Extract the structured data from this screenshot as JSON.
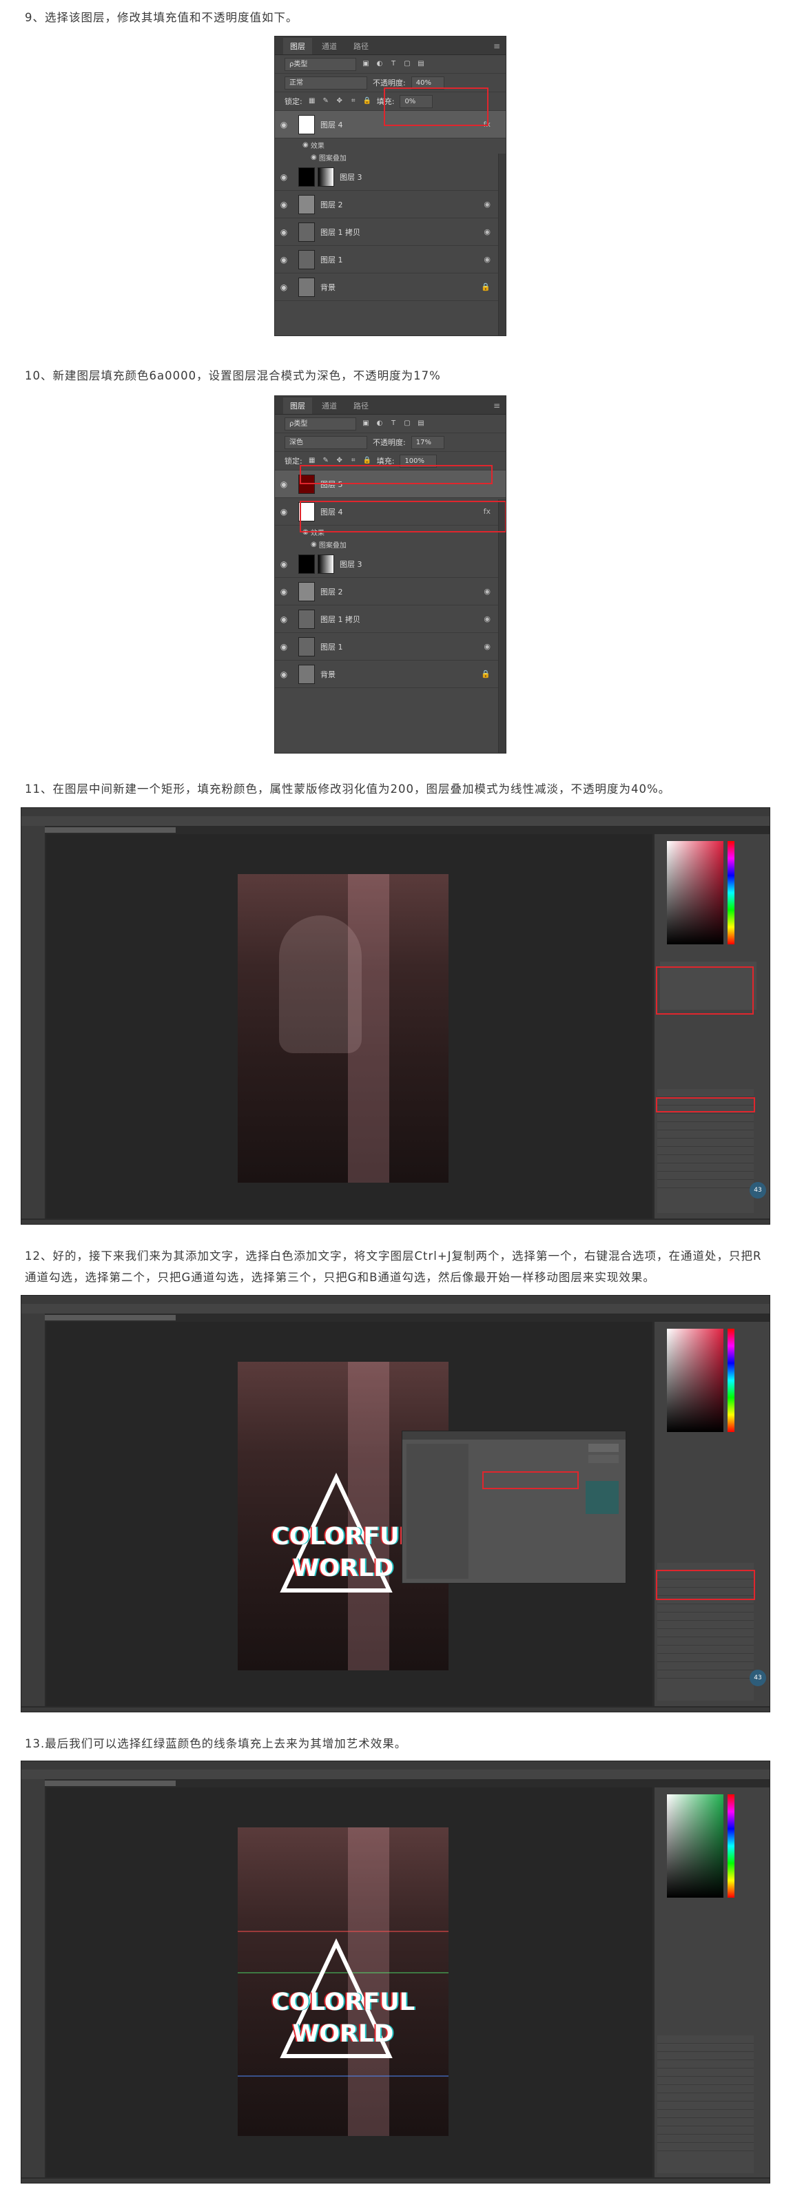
{
  "steps": {
    "s9": "9、选择该图层，修改其填充值和不透明度值如下。",
    "s10": "10、新建图层填充颜色6a0000，设置图层混合模式为深色，不透明度为17%",
    "s11": "11、在图层中间新建一个矩形，填充粉颜色，属性蒙版修改羽化值为200，图层叠加模式为线性减淡，不透明度为40%。",
    "s12": "12、好的，接下来我们来为其添加文字，选择白色添加文字，将文字图层Ctrl+J复制两个，选择第一个，右键混合选项，在通道处，只把R通道勾选，选择第二个，只把G通道勾选，选择第三个，只把G和B通道勾选，然后像最开始一样移动图层来实现效果。",
    "s13": "13.最后我们可以选择红绿蓝颜色的线条填充上去来为其增加艺术效果。"
  },
  "panel1": {
    "tabs": [
      "图层",
      "通道",
      "路径"
    ],
    "kind": "ρ类型",
    "blend": "正常",
    "opacity_label": "不透明度:",
    "opacity": "40%",
    "lock_label": "锁定:",
    "fill_label": "填充:",
    "fill": "0%",
    "layers": [
      {
        "name": "图层 4",
        "right": "fx",
        "thumb": "#ffffff"
      },
      {
        "name": "图层 3",
        "right": "",
        "thumb": "#000000"
      },
      {
        "name": "图层 2",
        "right": "◉",
        "thumb": "#888888"
      },
      {
        "name": "图层 1 拷贝",
        "right": "◉",
        "thumb": "#666666"
      },
      {
        "name": "图层 1",
        "right": "◉",
        "thumb": "#666666"
      },
      {
        "name": "背景",
        "right": "🔒",
        "thumb": "#777777"
      }
    ],
    "effects": "效果",
    "gradient_overlay": "图案叠加"
  },
  "panel2": {
    "tabs": [
      "图层",
      "通道",
      "路径"
    ],
    "kind": "ρ类型",
    "blend": "深色",
    "opacity_label": "不透明度:",
    "opacity": "17%",
    "lock_label": "锁定:",
    "fill_label": "填充:",
    "fill": "100%",
    "layers": [
      {
        "name": "图层 5",
        "right": "",
        "thumb": "#6a0000"
      },
      {
        "name": "图层 4",
        "right": "fx",
        "thumb": "#ffffff"
      },
      {
        "name": "图层 3",
        "right": "",
        "thumb": "#000000"
      },
      {
        "name": "图层 2",
        "right": "◉",
        "thumb": "#888888"
      },
      {
        "name": "图层 1 拷贝",
        "right": "◉",
        "thumb": "#666666"
      },
      {
        "name": "图层 1",
        "right": "◉",
        "thumb": "#666666"
      },
      {
        "name": "背景",
        "right": "🔒",
        "thumb": "#777777"
      }
    ],
    "effects": "效果",
    "gradient_overlay": "图案叠加"
  },
  "shot2": {
    "line1": "COLORFUL",
    "line2": "WORLD",
    "badge": "43"
  },
  "shot3": {
    "line1": "COLORFUL",
    "line2": "WORLD"
  },
  "shot1": {
    "badge": "43"
  },
  "colors": {
    "accent_red": "#e0262d",
    "dark_red_fill": "#6a0000",
    "panel_bg": "#474747"
  }
}
